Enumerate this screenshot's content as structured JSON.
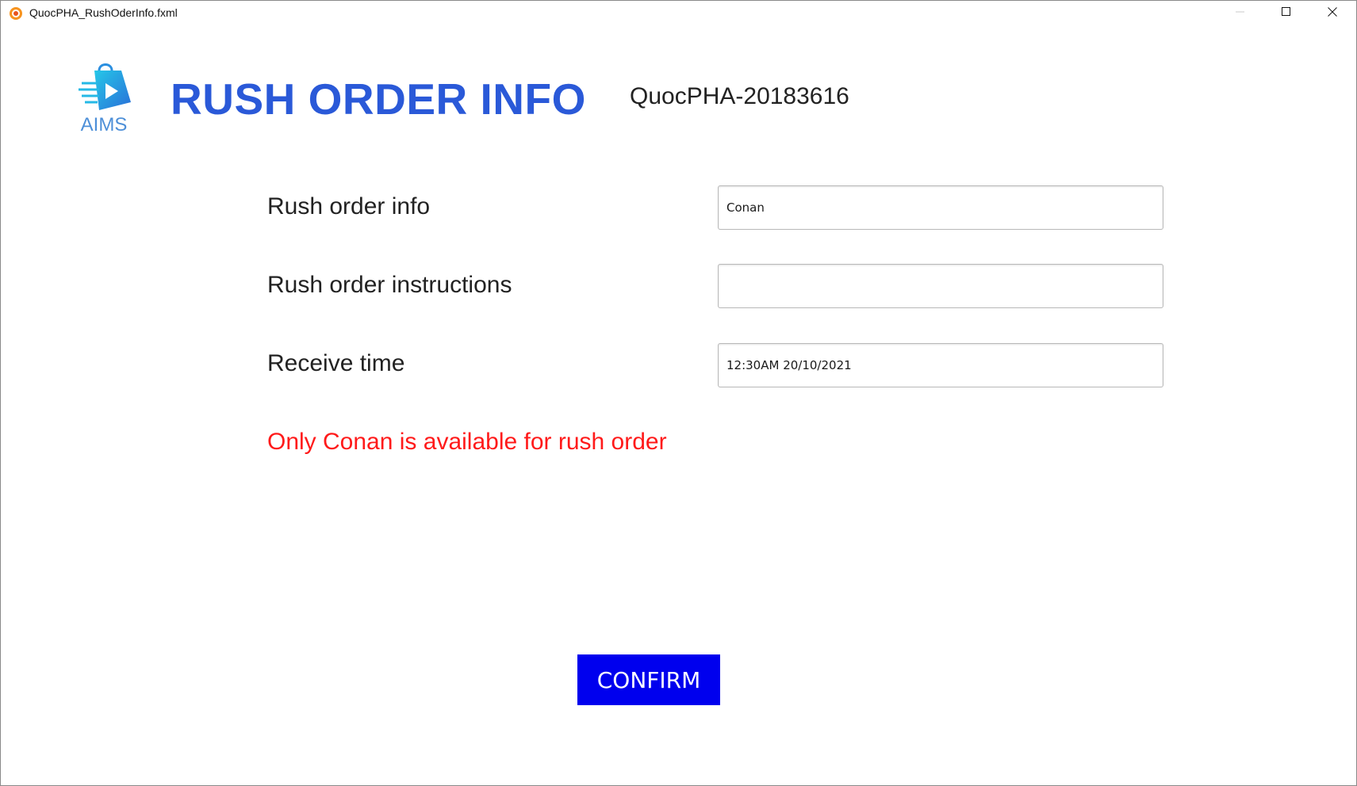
{
  "window": {
    "title": "QuocPHA_RushOderInfo.fxml",
    "app_icon": "app-icon",
    "controls": [
      "minimize-icon",
      "maximize-icon",
      "close-icon"
    ]
  },
  "header": {
    "logo_text": "AIMS",
    "title": "RUSH ORDER INFO",
    "user_id": "QuocPHA-20183616"
  },
  "form": {
    "rush_info_label": "Rush order info",
    "rush_info_value": "Conan",
    "instructions_label": "Rush order instructions",
    "instructions_value": "",
    "receive_time_label": "Receive time",
    "receive_time_value": "12:30AM 20/10/2021"
  },
  "error_message": "Only Conan is available for rush order",
  "confirm_label": "CONFIRM",
  "colors": {
    "title": "#2a59d8",
    "error": "#ff1a1a",
    "confirm_bg": "#0000ee",
    "confirm_text": "#ffffff"
  }
}
